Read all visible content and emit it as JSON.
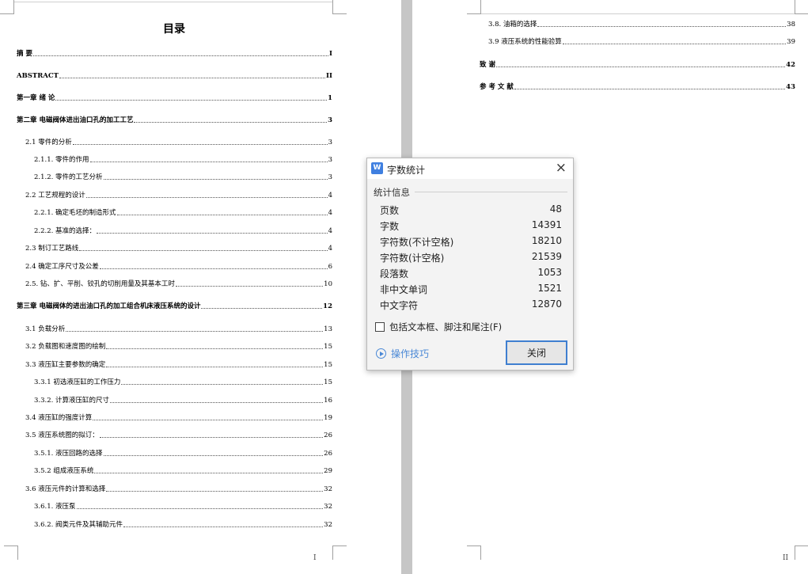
{
  "left_page": {
    "title": "目录",
    "toc": [
      {
        "text": "摘    要",
        "page": "I",
        "level": 0
      },
      {
        "text": "ABSTRACT",
        "page": "II",
        "level": 0
      },
      {
        "text": "第一章    绪    论",
        "page": "1",
        "level": 0
      },
      {
        "text": "第二章  电磁阀体进出油口孔的加工工艺",
        "page": "3",
        "level": 0
      },
      {
        "text": "2.1 零件的分析",
        "page": "3",
        "level": 1
      },
      {
        "text": "2.1.1. 零件的作用",
        "page": "3",
        "level": 2
      },
      {
        "text": "2.1.2. 零件的工艺分析",
        "page": "3",
        "level": 2
      },
      {
        "text": "2.2 工艺规程的设计",
        "page": "4",
        "level": 1
      },
      {
        "text": "2.2.1. 确定毛坯的制造形式",
        "page": "4",
        "level": 2
      },
      {
        "text": "2.2.2. 基准的选择：",
        "page": "4",
        "level": 2
      },
      {
        "text": "2.3 制订工艺路线",
        "page": "4",
        "level": 1
      },
      {
        "text": "2.4 确定工序尺寸及公差",
        "page": "6",
        "level": 1
      },
      {
        "text": "2.5. 钻、扩、平削、铰孔的切削用量及其基本工时",
        "page": "10",
        "level": 1
      },
      {
        "text": "第三章    电磁阀体的进出油口孔的加工组合机床液压系统的设计",
        "page": "12",
        "level": 0
      },
      {
        "text": "3.1 负载分析",
        "page": "13",
        "level": 1
      },
      {
        "text": "3.2 负载图和速度图的绘制",
        "page": "15",
        "level": 1
      },
      {
        "text": "3.3 液压缸主要参数的确定",
        "page": "15",
        "level": 1
      },
      {
        "text": "3.3.1 初选液压缸的工作压力",
        "page": "15",
        "level": 2
      },
      {
        "text": "3.3.2. 计算液压缸的尺寸",
        "page": "16",
        "level": 2
      },
      {
        "text": "3.4 液压缸的强度计算",
        "page": "19",
        "level": 1
      },
      {
        "text": "3.5 液压系统图的拟订：",
        "page": "26",
        "level": 1
      },
      {
        "text": "3.5.1. 液压回路的选择",
        "page": "26",
        "level": 2
      },
      {
        "text": "3.5.2 组成液压系统",
        "page": "29",
        "level": 2
      },
      {
        "text": "3.6 液压元件的计算和选择",
        "page": "32",
        "level": 1
      },
      {
        "text": "3.6.1. 液压泵",
        "page": "32",
        "level": 2
      },
      {
        "text": "3.6.2. 阀类元件及其辅助元件",
        "page": "32",
        "level": 2
      }
    ],
    "footer_page": "I"
  },
  "right_page": {
    "toc": [
      {
        "text": "3.8. 油箱的选择",
        "page": "38",
        "level": 2
      },
      {
        "text": "3.9 液压系统的性能验算",
        "page": "39",
        "level": 2
      },
      {
        "text": "致    谢",
        "page": "42",
        "level": 0
      },
      {
        "text": "参 考 文 献",
        "page": "43",
        "level": 0
      }
    ],
    "footer_page": "II"
  },
  "dialog": {
    "title": "字数统计",
    "app_icon": "W",
    "close_icon": "×",
    "group_label": "统计信息",
    "stats": [
      {
        "label": "页数",
        "value": "48"
      },
      {
        "label": "字数",
        "value": "14391"
      },
      {
        "label": "字符数(不计空格)",
        "value": "18210"
      },
      {
        "label": "字符数(计空格)",
        "value": "21539"
      },
      {
        "label": "段落数",
        "value": "1053"
      },
      {
        "label": "非中文单词",
        "value": "1521"
      },
      {
        "label": "中文字符",
        "value": "12870"
      }
    ],
    "checkbox_label": "包括文本框、脚注和尾注(F)",
    "checkbox_checked": false,
    "tips_label": "操作技巧",
    "close_button_label": "关闭",
    "accent_color": "#3f7fd0",
    "link_color": "#4a88d6"
  }
}
